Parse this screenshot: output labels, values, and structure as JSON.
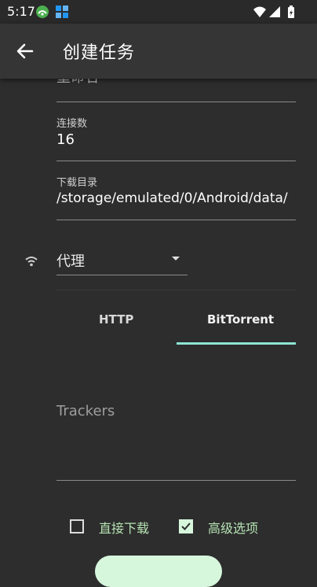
{
  "status_bar": {
    "time": "5:17"
  },
  "app_bar": {
    "title": "创建任务"
  },
  "form": {
    "cutoff_label": "重命名",
    "connections": {
      "label": "连接数",
      "value": "16"
    },
    "download_dir": {
      "label": "下载目录",
      "value": "/storage/emulated/0/Android/data/"
    },
    "proxy": {
      "label": "代理"
    }
  },
  "tabs": [
    {
      "label": "HTTP",
      "selected": false
    },
    {
      "label": "BitTorrent",
      "selected": true
    }
  ],
  "trackers": {
    "placeholder": "Trackers"
  },
  "checkboxes": [
    {
      "label": "直接下载",
      "checked": false
    },
    {
      "label": "高级选项",
      "checked": true
    }
  ],
  "colors": {
    "accent": "#8ee6d4",
    "check_label": "#b6e3b4",
    "fab": "#d7f7dd",
    "background": "#2d2d2d"
  }
}
